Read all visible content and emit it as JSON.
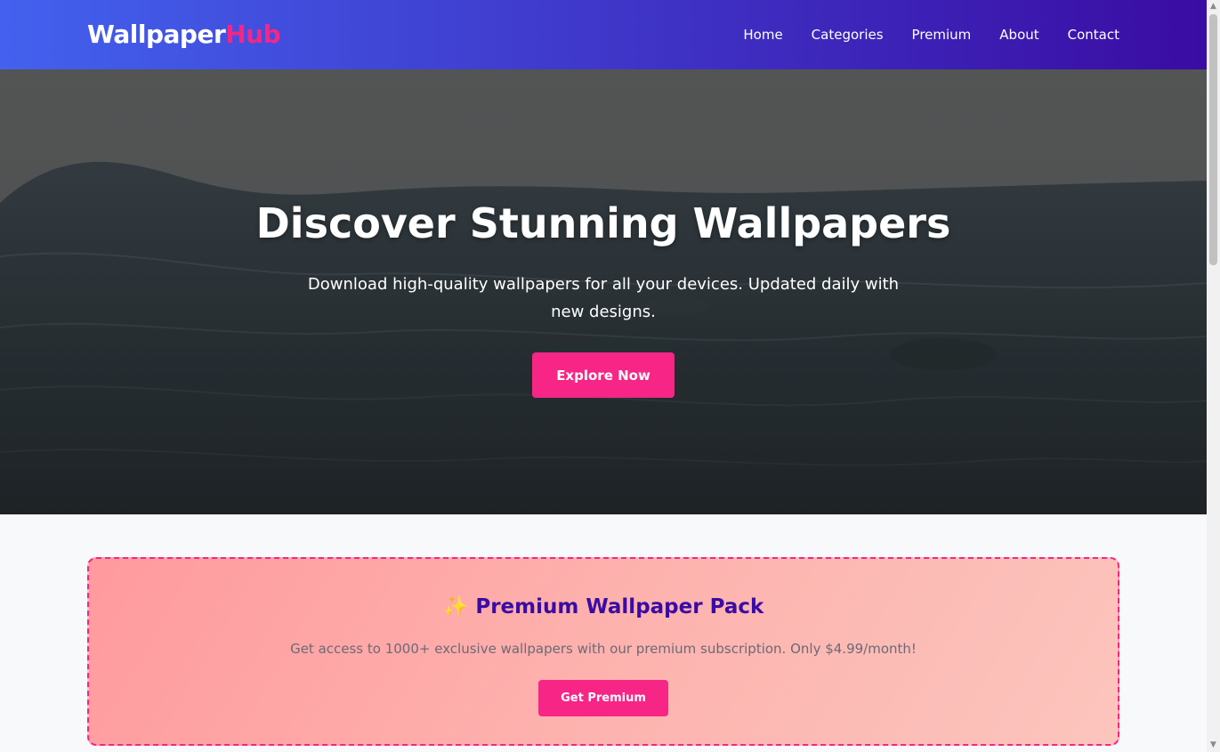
{
  "header": {
    "logo_part1": "Wallpaper",
    "logo_part2": "Hub",
    "nav": [
      "Home",
      "Categories",
      "Premium",
      "About",
      "Contact"
    ]
  },
  "hero": {
    "title": "Discover Stunning Wallpapers",
    "subtitle": "Download high-quality wallpapers for all your devices. Updated daily with new designs.",
    "button": "Explore Now"
  },
  "premium": {
    "icon": "sparkles-icon",
    "emoji": "✨",
    "title": "Premium Wallpaper Pack",
    "text": "Get access to 1000+ exclusive wallpapers with our premium subscription. Only $4.99/month!",
    "button": "Get Premium"
  },
  "colors": {
    "brand_gradient_start": "#4361ee",
    "brand_gradient_end": "#3a0ca3",
    "accent": "#f72585",
    "premium_title": "#3a0ca3"
  }
}
